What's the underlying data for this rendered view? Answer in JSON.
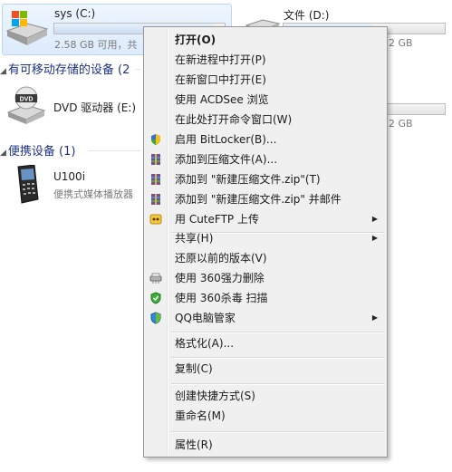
{
  "drives": {
    "sys": {
      "name": "sys (C:)",
      "space": "2.58 GB 可用，共",
      "used_fraction": 0.93
    },
    "d": {
      "name": "文件 (D:)",
      "space": "2 GB",
      "used_fraction": 0.55
    },
    "extra_space": "2 GB"
  },
  "groups": {
    "removable": "有可移动存储的设备 (2",
    "portable": "便携设备 (1)"
  },
  "dvd": {
    "name": "DVD 驱动器 (E:)"
  },
  "phone": {
    "name": "U100i",
    "sub": "便携式媒体播放器"
  },
  "menu": {
    "open": "打开(O)",
    "open_new_process": "在新进程中打开(P)",
    "open_new_window": "在新窗口中打开(E)",
    "acdsee": "使用 ACDSee 浏览",
    "cmd_here": "在此处打开命令窗口(W)",
    "bitlocker": "启用 BitLocker(B)...",
    "add_archive": "添加到压缩文件(A)...",
    "add_zip": "添加到 \"新建压缩文件.zip\"(T)",
    "add_zip_mail": "添加到 \"新建压缩文件.zip\" 并邮件",
    "cuteftp": "用 CuteFTP 上传",
    "share": "共享(H)",
    "restore_prev": "还原以前的版本(V)",
    "del360": "使用 360强力删除",
    "scan360": "使用 360杀毒 扫描",
    "qq": "QQ电脑管家",
    "format": "格式化(A)...",
    "copy": "复制(C)",
    "shortcut": "创建快捷方式(S)",
    "rename": "重命名(M)",
    "properties": "属性(R)"
  }
}
